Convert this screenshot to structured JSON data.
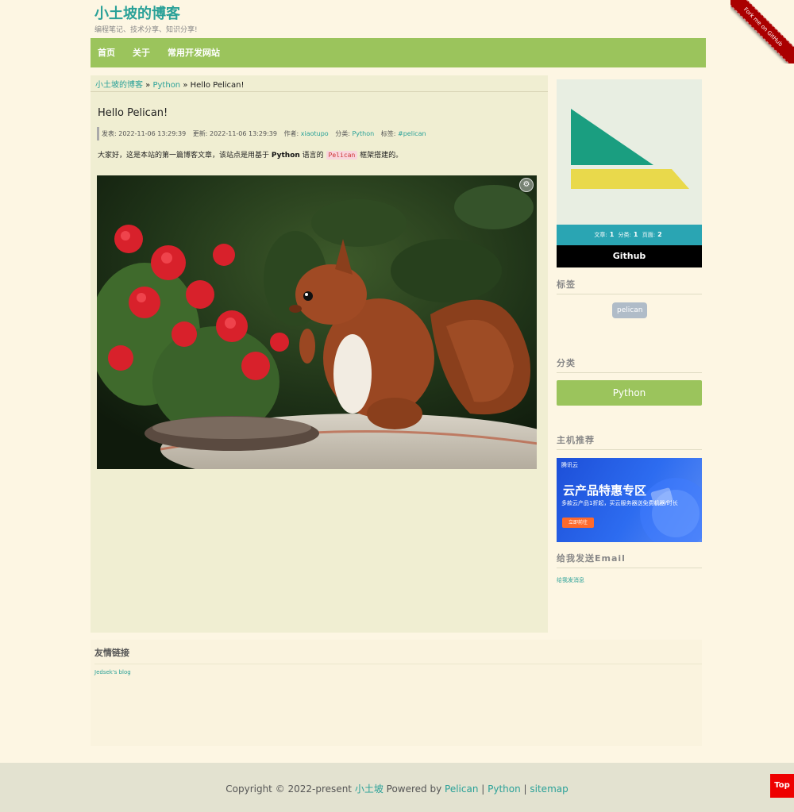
{
  "site": {
    "title": "小土坡的博客",
    "subtitle": "编程笔记、技术分享、知识分享!",
    "fork_ribbon": "Fork me on GitHub"
  },
  "nav": {
    "items": [
      {
        "label": "首页"
      },
      {
        "label": "关于"
      },
      {
        "label": "常用开发网站"
      }
    ]
  },
  "breadcrumb": {
    "home": "小土坡的博客",
    "sep1": " » ",
    "category": "Python",
    "sep2": " » ",
    "current": "Hello Pelican!"
  },
  "post": {
    "title": "Hello Pelican!",
    "meta": {
      "published": "发表: 2022-11-06 13:29:39",
      "updated": "更新: 2022-11-06 13:29:39",
      "author_label": "作者: ",
      "author": "xiaotupo",
      "category_label": "分类: ",
      "category": "Python",
      "tags_label": "标签: ",
      "tag": "#pelican"
    },
    "body": {
      "part1": "大家好，这是本站的第一篇博客文章，该站点是用基于 ",
      "bold": "Python",
      "part2": " 语言的 ",
      "code": "Pelican",
      "part3": " 框架搭建的。"
    },
    "image_alt": "squirrel",
    "zoom_icon": "zoom-icon"
  },
  "sidebar": {
    "stats": {
      "articles_label": "文章:",
      "articles": "1",
      "categories_label": "分类:",
      "categories": "1",
      "pages_label": "页面:",
      "pages": "2"
    },
    "github": "Github",
    "tags_heading": "标签",
    "tags": [
      "pelican"
    ],
    "categories_heading": "分类",
    "categories": [
      "Python"
    ],
    "host_heading": "主机推荐",
    "ad": {
      "brand": "腾讯云",
      "title": "云产品特惠专区",
      "subtitle": "多款云产品1折起，买云服务器送免费机器/时长",
      "button": "立即前往"
    },
    "email_heading": "给我发送Email",
    "email_link": "给我发消息"
  },
  "friends": {
    "heading": "友情链接",
    "links": [
      "Jedsek's blog"
    ]
  },
  "footer": {
    "copyright": "Copyright © 2022-present ",
    "owner": "小土坡",
    "powered": " Powered by ",
    "pelican": "Pelican",
    "sep1": " | ",
    "python": "Python",
    "sep2": " | ",
    "sitemap": "sitemap"
  },
  "top_button": "Top",
  "colors": {
    "background": "#fdf6e3",
    "accent": "#2aa198",
    "nav": "#9bc45c",
    "stats_bar": "#2aa5b3"
  }
}
